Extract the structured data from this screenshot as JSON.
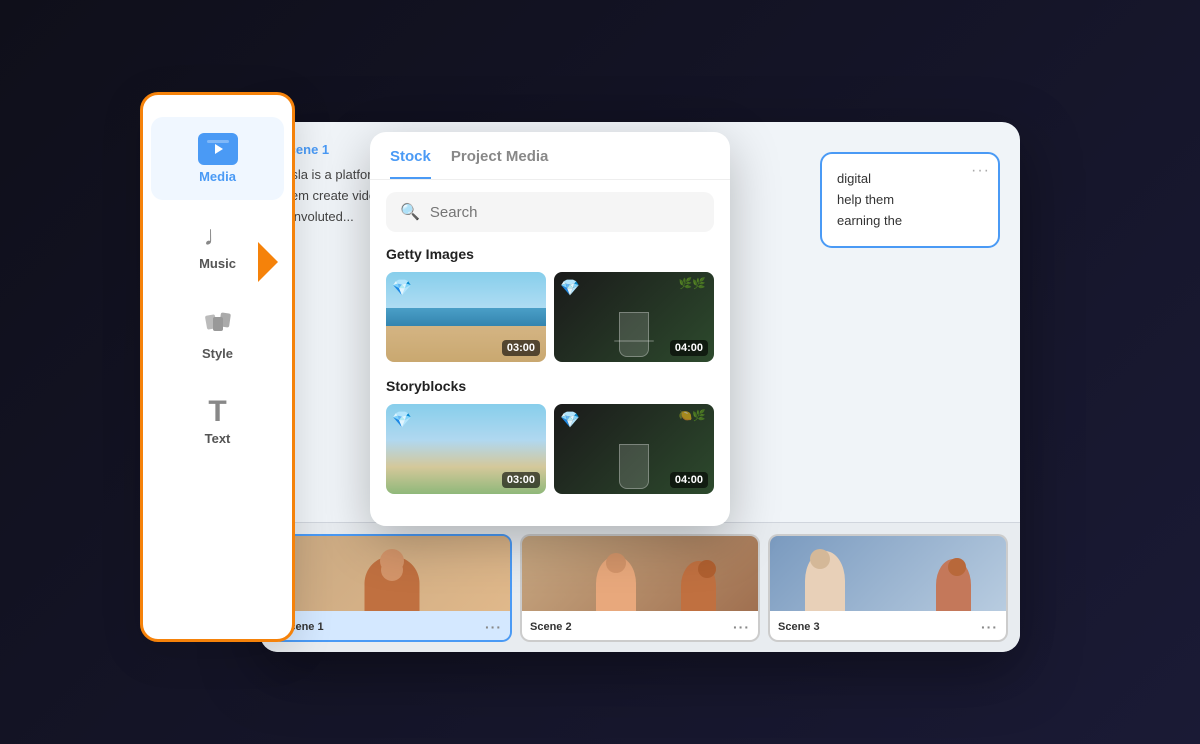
{
  "sidebar": {
    "items": [
      {
        "id": "media",
        "label": "Media",
        "icon": "media",
        "active": true
      },
      {
        "id": "music",
        "label": "Music",
        "icon": "music"
      },
      {
        "id": "style",
        "label": "Style",
        "icon": "style"
      },
      {
        "id": "text",
        "label": "Text",
        "icon": "text"
      }
    ]
  },
  "popup": {
    "tabs": [
      {
        "id": "stock",
        "label": "Stock",
        "active": true
      },
      {
        "id": "project-media",
        "label": "Project Media",
        "active": false
      }
    ],
    "search": {
      "placeholder": "Search"
    },
    "sections": [
      {
        "title": "Getty Images",
        "items": [
          {
            "type": "beach",
            "duration": "03:00"
          },
          {
            "type": "drink",
            "duration": "04:00"
          }
        ]
      },
      {
        "title": "Storyblocks",
        "items": [
          {
            "type": "beach2",
            "duration": "03:00"
          },
          {
            "type": "drink2",
            "duration": "04:00"
          }
        ]
      }
    ]
  },
  "editor": {
    "scenes": [
      {
        "id": "scene-1",
        "label": "Scene 1",
        "text": "Visla is a platform for digital marketers to help them create video content learning the convoluted...",
        "active": true
      },
      {
        "id": "scene-2",
        "label": "Scene 2",
        "active": false
      },
      {
        "id": "scene-3",
        "label": "Scene 3",
        "active": false
      }
    ],
    "right_text": "digital help them earning the"
  }
}
